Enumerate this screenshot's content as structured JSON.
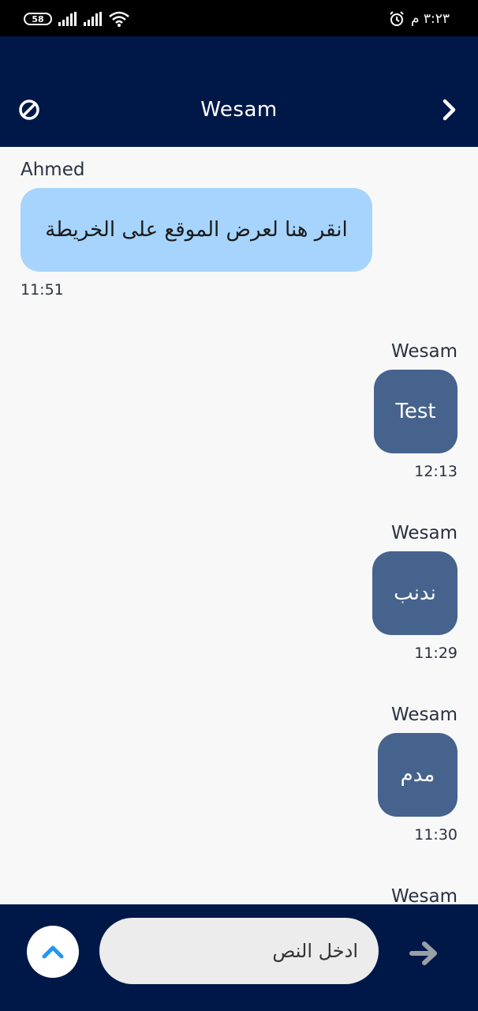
{
  "status_bar": {
    "battery": "58",
    "time": "٣:٢٣ م"
  },
  "header": {
    "title": "Wesam"
  },
  "messages": [
    {
      "sender": "Ahmed",
      "text": "انقر هنا لعرض الموقع على الخريطة",
      "time": "11:51",
      "direction": "incoming"
    },
    {
      "sender": "Wesam",
      "text": "Test",
      "time": "12:13",
      "direction": "outgoing"
    },
    {
      "sender": "Wesam",
      "text": "ندنب",
      "time": "11:29",
      "direction": "outgoing"
    },
    {
      "sender": "Wesam",
      "text": "مدم",
      "time": "11:30",
      "direction": "outgoing"
    },
    {
      "sender": "Wesam",
      "text": "",
      "time": "",
      "direction": "outgoing"
    }
  ],
  "composer": {
    "placeholder": "ادخل النص"
  },
  "colors": {
    "appbar": "#001848",
    "incoming_bubble": "#a6d4fc",
    "outgoing_bubble": "#45638c",
    "accent": "#2196f3"
  }
}
